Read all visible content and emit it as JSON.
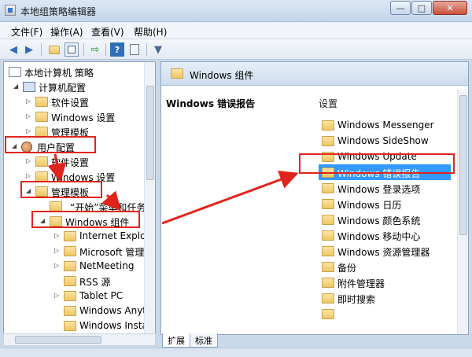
{
  "window": {
    "title": "本地组策略编辑器",
    "min": "—",
    "max": "□",
    "close": "✕"
  },
  "menu": {
    "file": "文件(F)",
    "action": "操作(A)",
    "view": "查看(V)",
    "help": "帮助(H)"
  },
  "tree": {
    "root": "本地计算机 策略",
    "computer_config": "计算机配置",
    "cc_software": "软件设置",
    "cc_windows": "Windows 设置",
    "cc_templates": "管理模板",
    "user_config": "用户配置",
    "uc_software": "软件设置",
    "uc_windows": "Windows 设置",
    "uc_templates": "管理模板",
    "start_menu": "“开始”菜单和任务",
    "windows_components": "Windows 组件",
    "children": [
      "Internet Explor",
      "Microsoft 管理",
      "NetMeeting",
      "RSS 源",
      "Tablet PC",
      "Windows Anyti",
      "Windows Insta"
    ]
  },
  "right": {
    "header_title": "Windows 组件",
    "description_title": "Windows 错误报告",
    "column_header": "设置",
    "items": [
      "Windows Messenger",
      "Windows SideShow",
      "Windows Update",
      "Windows 错误报告",
      "Windows 登录选项",
      "Windows 日历",
      "Windows 颜色系统",
      "Windows 移动中心",
      "Windows 资源管理器",
      "备份",
      "附件管理器",
      "即时搜索"
    ]
  },
  "tabs": {
    "extended": "扩展",
    "standard": "标准"
  },
  "colors": {
    "annotation": "#e0241b",
    "selection": "#3399ff"
  }
}
